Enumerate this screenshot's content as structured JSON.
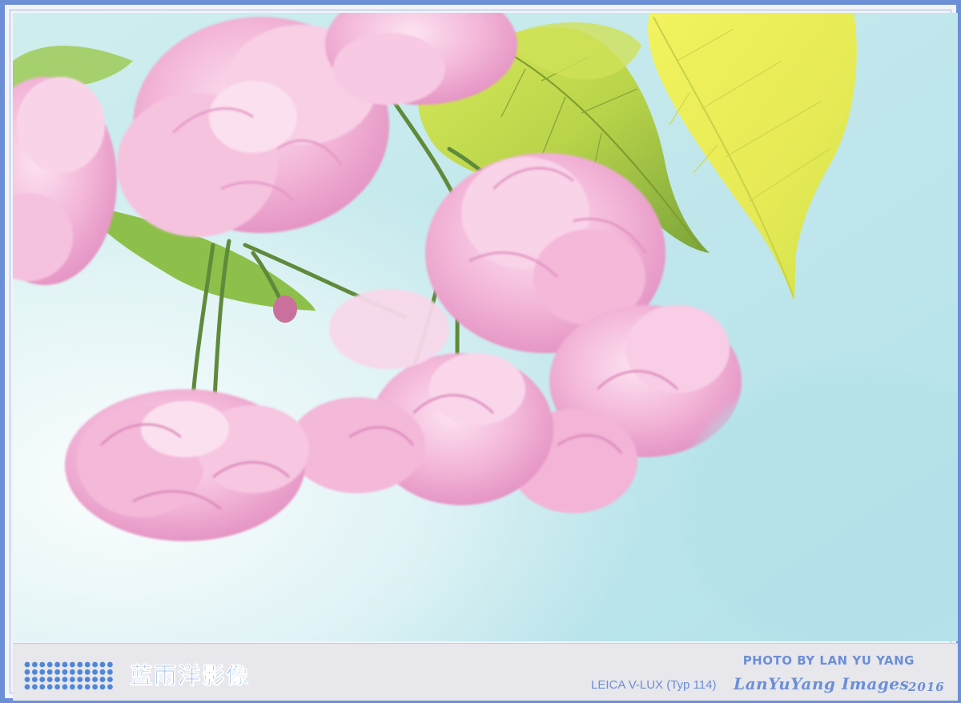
{
  "caption": {
    "brand_cn": "蓝雨洋影像",
    "credit": "PHOTO BY LAN YU YANG",
    "camera": "LEICA V-LUX (Typ 114)",
    "signature": "LanYuYang Images",
    "year": "2016"
  },
  "photo": {
    "subject": "pink double cherry blossom cluster with green and yellow leaves",
    "colors": {
      "sky": "#bfe7ec",
      "sky_light": "#e9f6f6",
      "petal": "#f3b3d6",
      "petal_dark": "#e08fc0",
      "leaf_yellow": "#e6ee6a",
      "leaf_green": "#8fc34a",
      "stem": "#5f8a3a"
    }
  },
  "frame": {
    "border_color": "#6c8fd6",
    "caption_bg": "#e7e7ec"
  }
}
